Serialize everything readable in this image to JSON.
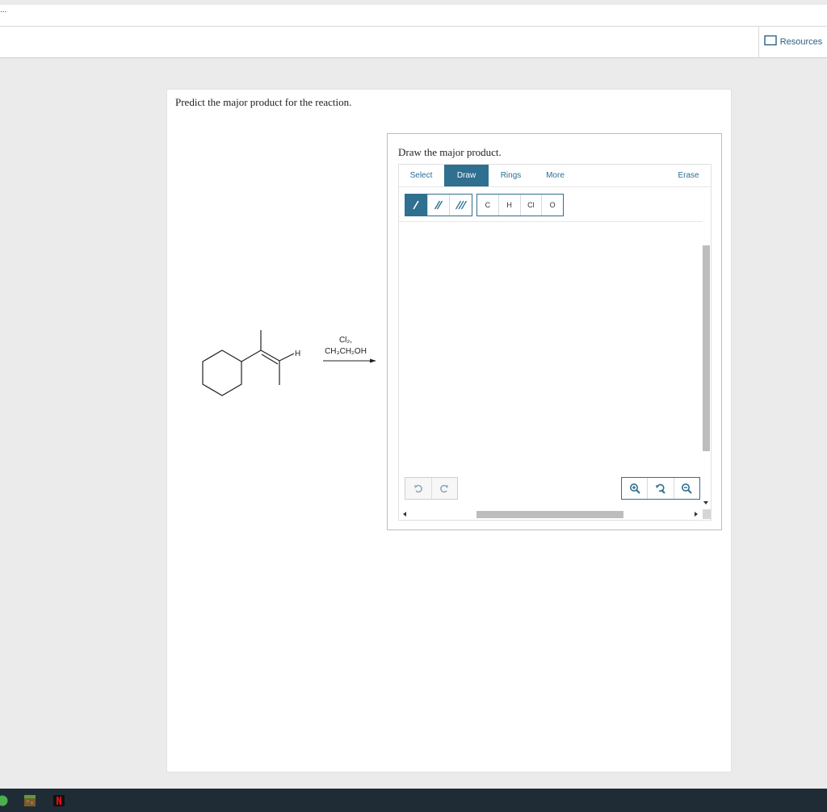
{
  "top": {
    "ellipsis": "..."
  },
  "header": {
    "resources_label": "Resources"
  },
  "question": {
    "text": "Predict the major product for the reaction."
  },
  "reaction": {
    "substituent_h": "H",
    "reagent_line1": "Cl₂,",
    "reagent_line2": "CH₃CH₂OH"
  },
  "sketcher": {
    "title": "Draw the major product.",
    "tabs": [
      {
        "label": "Select"
      },
      {
        "label": "Draw"
      },
      {
        "label": "Rings"
      },
      {
        "label": "More"
      },
      {
        "label": "Erase"
      }
    ],
    "active_tab": "Draw",
    "atoms": [
      "C",
      "H",
      "Cl",
      "O"
    ],
    "bond_tools": [
      "single-bond-icon",
      "double-bond-icon",
      "triple-bond-icon"
    ],
    "history_tools": [
      "undo-icon",
      "redo-icon"
    ],
    "zoom_tools": [
      "zoom-in-icon",
      "zoom-reset-icon",
      "zoom-out-icon"
    ]
  },
  "colors": {
    "accent": "#2f6f8f",
    "link": "#2a6f97",
    "taskbar": "#1f2c36"
  }
}
